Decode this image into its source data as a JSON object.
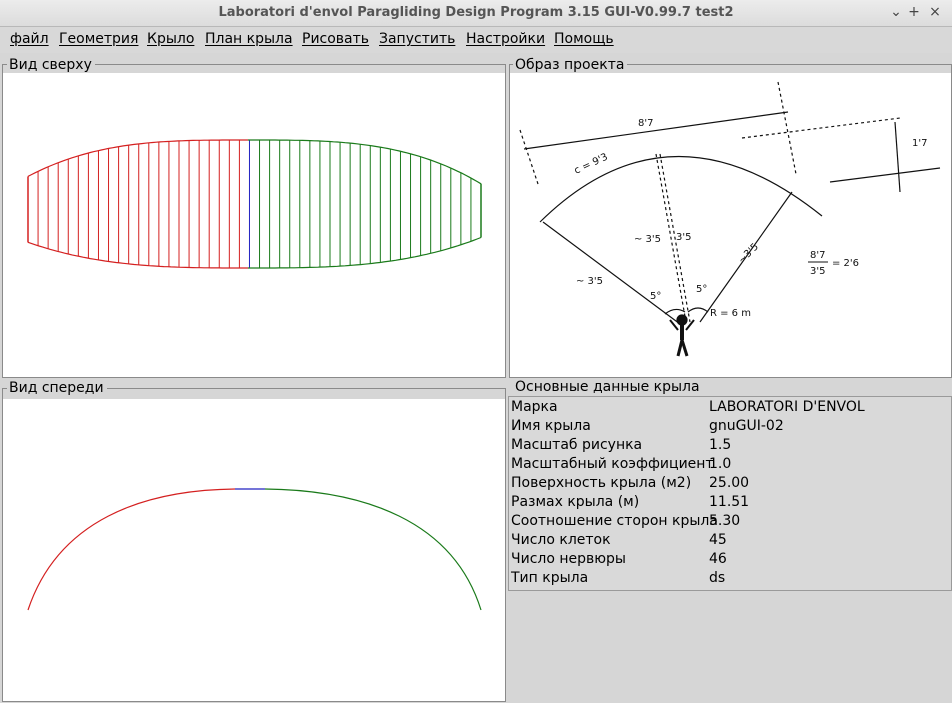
{
  "window": {
    "title": "Laboratori d'envol Paragliding Design Program 3.15 GUI-V0.99.7 test2",
    "controls": [
      "⌄",
      "+",
      "×"
    ]
  },
  "menu": [
    "файл",
    "Геометрия",
    "Крыло",
    "План крыла",
    "Рисовать",
    "Запустить",
    "Настройки",
    "Помощь"
  ],
  "panels": {
    "top_view": "Вид сверху",
    "project_image": "Образ проекта",
    "front_view": "Вид спереди",
    "wing_data": "Основные данные крыла"
  },
  "colors": {
    "left_half": "#d42020",
    "right_half": "#1a7a1a",
    "center": "#2020c0"
  },
  "sketch_text": {
    "top_dim": "8'7",
    "right_dim": "1'7",
    "arc_len": "c = 9'3",
    "ratio_num": "8'7",
    "ratio_den": "3'5",
    "ratio_eq": "= 2'6",
    "line_left": "~ 3'5",
    "line_right": "~3'5",
    "center_left": "~ 3'5",
    "center_right": "3'5",
    "angle_left": "5°",
    "angle_right": "5°",
    "radius": "R = 6 m"
  },
  "wing_data": [
    {
      "key": "Марка",
      "value": "LABORATORI D'ENVOL"
    },
    {
      "key": "Имя крыла",
      "value": "gnuGUI-02"
    },
    {
      "key": "Масштаб рисунка",
      "value": "1.5"
    },
    {
      "key": "Масштабный коэффициент",
      "value": "1.0"
    },
    {
      "key": "Поверхность крыла (м2)",
      "value": "25.00"
    },
    {
      "key": "Размах крыла (м)",
      "value": "11.51"
    },
    {
      "key": "Соотношение сторон крыла",
      "value": "5.30"
    },
    {
      "key": "Число клеток",
      "value": "45"
    },
    {
      "key": "Число нервюры",
      "value": "46"
    },
    {
      "key": "Тип крыла",
      "value": "ds"
    }
  ]
}
